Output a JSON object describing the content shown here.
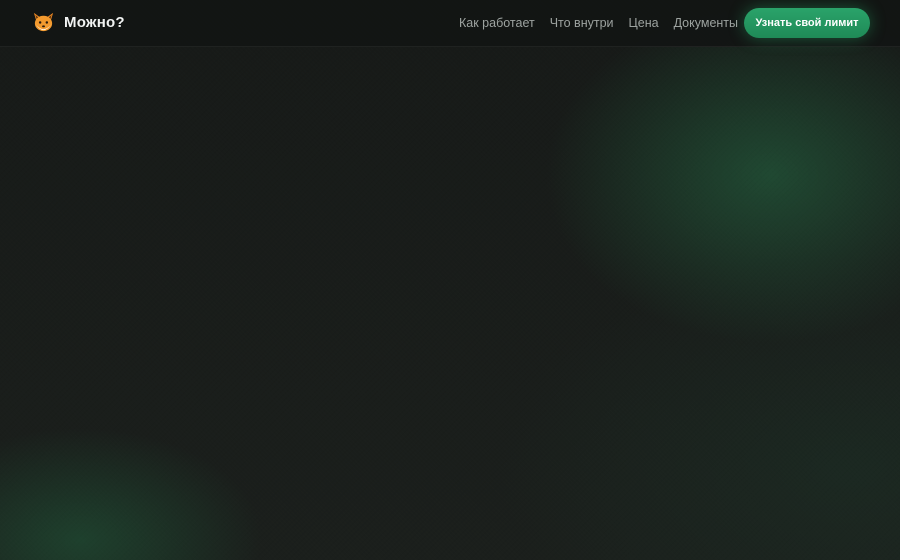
{
  "header": {
    "brand": {
      "icon": "fox-face-icon",
      "name": "Можно?"
    },
    "nav": [
      {
        "label": "Как работает"
      },
      {
        "label": "Что внутри"
      },
      {
        "label": "Цена"
      },
      {
        "label": "Документы"
      }
    ],
    "cta_label": "Узнать свой лимит"
  },
  "colors": {
    "accent": "#239a60",
    "background": "#191c1a",
    "nav_text": "#9da3a0",
    "brand_text": "#f2f4f3"
  }
}
